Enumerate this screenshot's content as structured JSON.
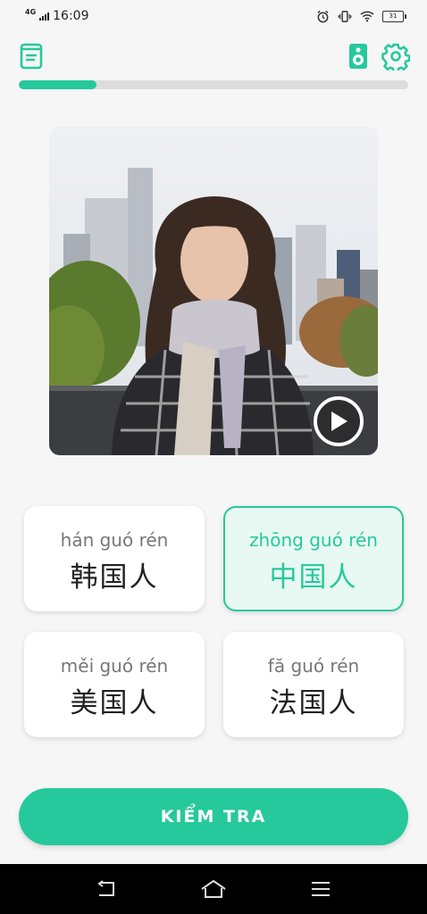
{
  "status_bar": {
    "network": "4G",
    "time": "16:09",
    "battery": "31",
    "icons": [
      "signal-icon",
      "alarm-icon",
      "vibrate-icon",
      "wifi-icon",
      "battery-icon"
    ]
  },
  "toolbar": {
    "left_icon": "book-icon",
    "right_icons": [
      "speaker-icon",
      "gear-icon"
    ]
  },
  "progress": {
    "fraction": 0.2
  },
  "video": {
    "play_icon": "play-icon"
  },
  "options": [
    {
      "pinyin": "hán guó rén",
      "hanzi": "韩国人",
      "selected": false
    },
    {
      "pinyin": "zhōng guó rén",
      "hanzi": "中国人",
      "selected": true
    },
    {
      "pinyin": "měi guó rén",
      "hanzi": "美国人",
      "selected": false
    },
    {
      "pinyin": "fă guó rén",
      "hanzi": "法国人",
      "selected": false
    }
  ],
  "check_button": {
    "label": "KIỂM TRA"
  },
  "navigation_bar": {
    "icons": [
      "back-icon",
      "home-icon",
      "menu-icon"
    ]
  },
  "colors": {
    "accent": "#26c99c",
    "selected_bg": "#e8f8f2",
    "background": "#f6f6f6"
  }
}
